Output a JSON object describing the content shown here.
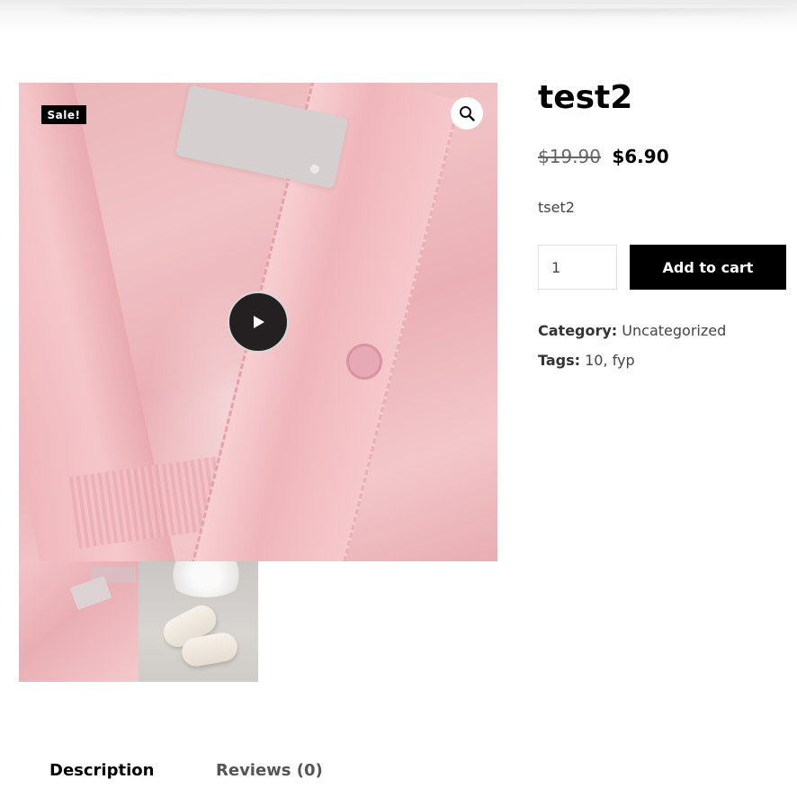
{
  "gallery": {
    "sale_badge": "Sale!",
    "zoom_icon": "magnifier-icon",
    "play_icon": "play-icon",
    "thumbnails": [
      "pink-shirt",
      "white-shoes"
    ]
  },
  "product": {
    "title": "test2",
    "price_old": "$19.90",
    "price_new": "$6.90",
    "short_description": "tset2",
    "quantity": "1",
    "add_to_cart_label": "Add to cart",
    "category_label": "Category:",
    "category": "Uncategorized",
    "tags_label": "Tags:",
    "tags": [
      "10",
      "fyp"
    ]
  },
  "tabs": [
    {
      "label": "Description",
      "active": true
    },
    {
      "label": "Reviews (0)",
      "active": false
    }
  ],
  "colors": {
    "button_bg": "#000000",
    "sale_badge_bg": "#000000"
  }
}
